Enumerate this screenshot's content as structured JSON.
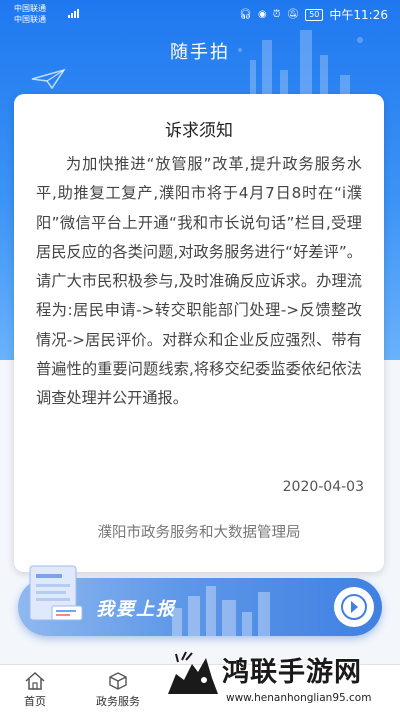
{
  "status_bar": {
    "carrier_1": "中国联通",
    "carrier_2": "中国联通",
    "network": "4G",
    "battery": "50",
    "time": "中午11:26"
  },
  "header": {
    "title": "随手拍"
  },
  "notice": {
    "title": "诉求须知",
    "body": "为加快推进“放管服”改革,提升政务服务水平,助推复工复产,濮阳市将于4月7日8时在“i濮阳”微信平台上开通“我和市长说句话”栏目,受理居民反应的各类问题,对政务服务进行“好差评”。请广大市民积极参与,及时准确反应诉求。办理流程为:居民申请->转交职能部门处理->反馈整改情况->居民评价。对群众和企业反应强烈、带有普遍性的重要问题线索,将移交纪委监委依纪依法调查处理并公开通报。",
    "date": "2020-04-03",
    "issuer": "濮阳市政务服务和大数据管理局"
  },
  "report_button": {
    "label": "我要上报"
  },
  "tabbar": {
    "items": [
      {
        "label": "首页"
      },
      {
        "label": "政务服务"
      }
    ]
  },
  "watermark": {
    "text": "鸿联手游网",
    "url": "www.henanhonglian95.com"
  },
  "colors": {
    "header_blue": "#2a82f1",
    "button_blue": "#3f80e2"
  }
}
